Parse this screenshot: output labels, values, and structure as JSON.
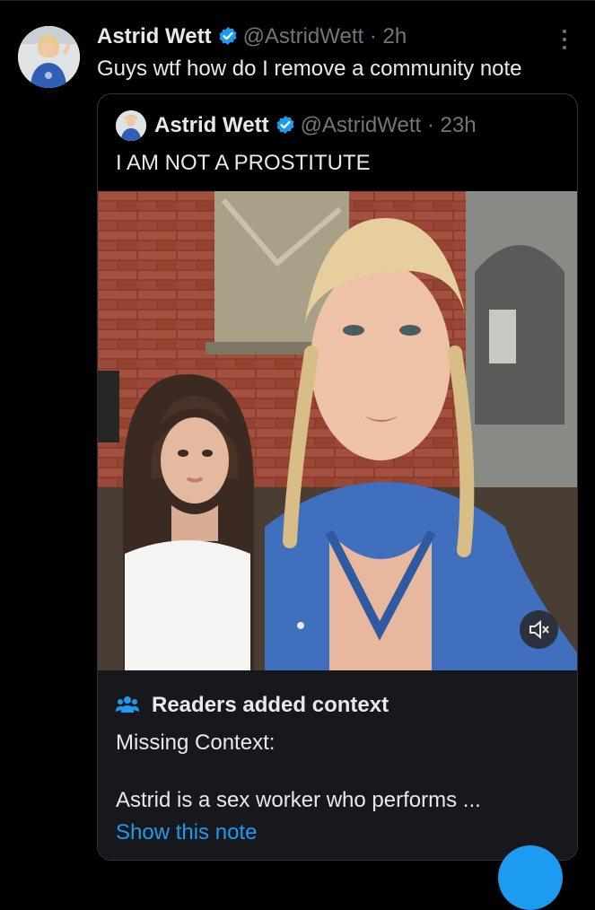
{
  "tweet": {
    "author_name": "Astrid Wett",
    "handle": "@AstridWett",
    "separator": "·",
    "time": "2h",
    "text": "Guys wtf how do I remove a community note"
  },
  "quoted_tweet": {
    "author_name": "Astrid Wett",
    "handle": "@AstridWett",
    "separator": "·",
    "time": "23h",
    "text": "I AM NOT A PROSTITUTE"
  },
  "community_note": {
    "title": "Readers added context",
    "label": "Missing Context:",
    "body": "Astrid is a sex worker who performs ...",
    "link": "Show this note"
  },
  "icons": {
    "verified": "verified-badge-icon",
    "more": "more-vertical-icon",
    "mute": "speaker-muted-icon",
    "people": "people-icon"
  },
  "colors": {
    "background": "#000000",
    "text": "#e7e9ea",
    "muted": "#71767b",
    "accent": "#1d9bf0",
    "note_background": "#16181c"
  }
}
